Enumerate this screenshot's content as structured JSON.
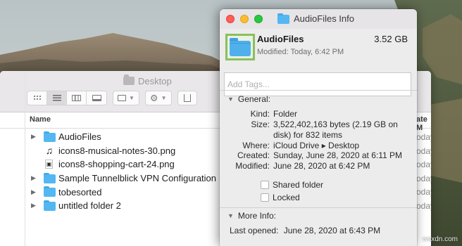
{
  "finder": {
    "title": "Desktop",
    "column_name": "Name",
    "column_date": "ate M",
    "date_values": [
      "oday",
      "oday",
      "oday",
      "oday",
      "oday",
      "oday"
    ],
    "items": [
      {
        "name": "AudioFiles",
        "kind": "folder",
        "expandable": true
      },
      {
        "name": "icons8-musical-notes-30.png",
        "kind": "image",
        "expandable": false
      },
      {
        "name": "icons8-shopping-cart-24.png",
        "kind": "image",
        "expandable": false
      },
      {
        "name": "Sample Tunnelblick VPN Configuration",
        "kind": "folder",
        "expandable": true
      },
      {
        "name": "tobesorted",
        "kind": "folder",
        "expandable": true
      },
      {
        "name": "untitled folder 2",
        "kind": "folder",
        "expandable": true
      }
    ]
  },
  "info": {
    "window_title": "AudioFiles Info",
    "name": "AudioFiles",
    "size": "3.52 GB",
    "modified_summary": "Modified: Today, 6:42 PM",
    "tags_placeholder": "Add Tags...",
    "general_label": "General:",
    "kind_label": "Kind:",
    "kind_value": "Folder",
    "size_label": "Size:",
    "size_value_line1": "3,522,402,163 bytes (2.19 GB on",
    "size_value_line2": "disk) for 832 items",
    "where_label": "Where:",
    "where_value": "iCloud Drive ▸ Desktop",
    "created_label": "Created:",
    "created_value": "Sunday, June 28, 2020 at 6:11 PM",
    "modified_label": "Modified:",
    "modified_value": "June 28, 2020 at 6:42 PM",
    "shared_folder_label": "Shared folder",
    "shared_folder_checked": false,
    "locked_label": "Locked",
    "locked_checked": false,
    "more_info_label": "More Info:",
    "last_opened_label": "Last opened:",
    "last_opened_value": "June 28, 2020 at 6:43 PM"
  },
  "watermark": "wsxdn.com",
  "colors": {
    "folder_blue": "#53b7f1",
    "close": "#fe5f57",
    "minimize": "#febc2e",
    "zoom": "#28c840",
    "selection_highlight": "#8bbf5d"
  }
}
